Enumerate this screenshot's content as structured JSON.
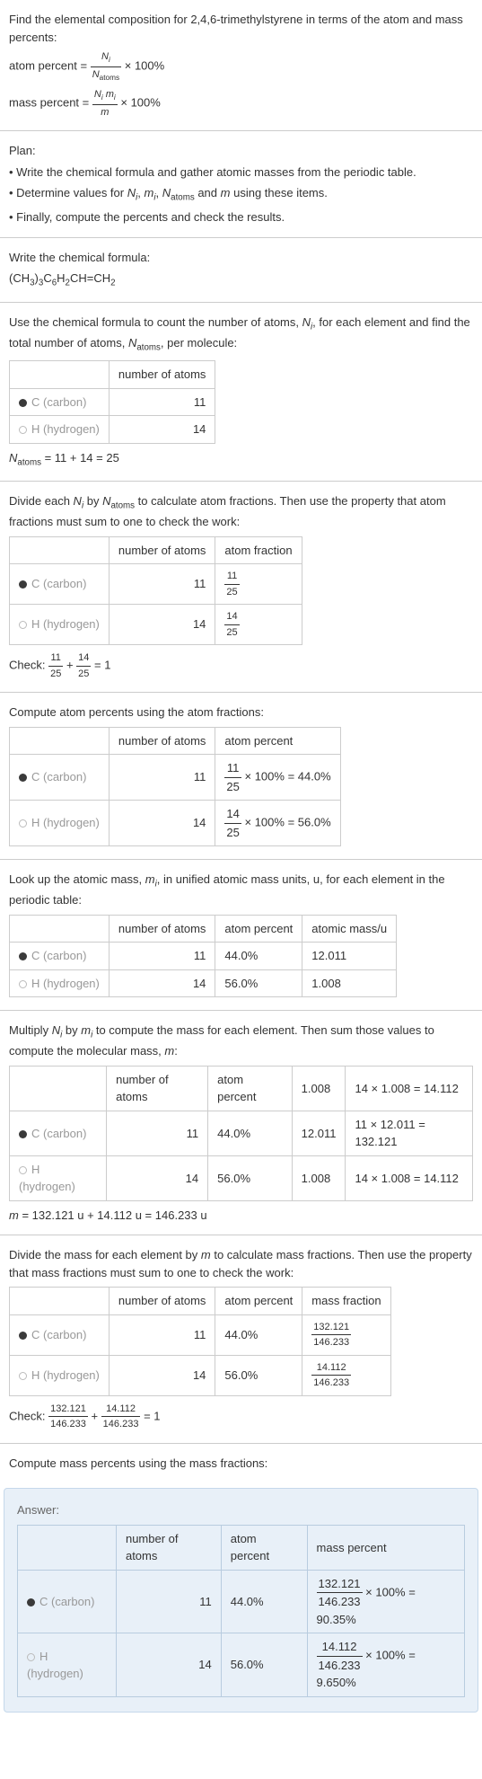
{
  "intro": {
    "line1": "Find the elemental composition for 2,4,6-trimethylstyrene in terms of the atom and mass percents:",
    "atom_label": "atom percent = ",
    "atom_frac_num": "N_i",
    "atom_frac_den": "N_atoms",
    "times100": " × 100%",
    "mass_label": "mass percent = ",
    "mass_frac_num": "N_i m_i",
    "mass_frac_den": "m"
  },
  "plan": {
    "title": "Plan:",
    "b1": "• Write the chemical formula and gather atomic masses from the periodic table.",
    "b2_a": "• Determine values for ",
    "b2_b": "N_i, m_i, N_atoms",
    "b2_c": " and ",
    "b2_d": "m",
    "b2_e": " using these items.",
    "b3": "• Finally, compute the percents and check the results."
  },
  "formula_section": {
    "title": "Write the chemical formula:",
    "formula": "(CH₃)₃C₆H₂CH=CH₂"
  },
  "count_section": {
    "text_a": "Use the chemical formula to count the number of atoms, ",
    "text_b": "N_i",
    "text_c": ", for each element and find the total number of atoms, ",
    "text_d": "N_atoms",
    "text_e": ", per molecule:",
    "h_atoms": "number of atoms",
    "c_label": "C (carbon)",
    "c_atoms": "11",
    "h_label": "H (hydrogen)",
    "h_atoms_val": "14",
    "eq": "N_atoms = 11 + 14 = 25"
  },
  "atomfrac_section": {
    "text_a": "Divide each ",
    "text_b": "N_i",
    "text_c": " by ",
    "text_d": "N_atoms",
    "text_e": " to calculate atom fractions. Then use the property that atom fractions must sum to one to check the work:",
    "h_atoms": "number of atoms",
    "h_frac": "atom fraction",
    "c_atoms": "11",
    "c_frac_num": "11",
    "c_frac_den": "25",
    "h_atoms_val": "14",
    "h_frac_num": "14",
    "h_frac_den": "25",
    "check_label": "Check: ",
    "check_eq": " = 1"
  },
  "atompct_section": {
    "title": "Compute atom percents using the atom fractions:",
    "h_atoms": "number of atoms",
    "h_pct": "atom percent",
    "c_atoms": "11",
    "c_calc": " × 100% = 44.0%",
    "h_atoms_val": "14",
    "h_calc": " × 100% = 56.0%"
  },
  "mass_lookup": {
    "text_a": "Look up the atomic mass, ",
    "text_b": "m_i",
    "text_c": ", in unified atomic mass units, u, for each element in the periodic table:",
    "h_atoms": "number of atoms",
    "h_pct": "atom percent",
    "h_mass": "atomic mass/u",
    "c_atoms": "11",
    "c_pct": "44.0%",
    "c_mass": "12.011",
    "h_atoms_val": "14",
    "h_pct_val": "56.0%",
    "h_mass_val": "1.008"
  },
  "massmult": {
    "text_a": "Multiply ",
    "text_b": "N_i",
    "text_c": " by ",
    "text_d": "m_i",
    "text_e": " to compute the mass for each element. Then sum those values to compute the molecular mass, ",
    "text_f": "m:",
    "h_atoms": "number of atoms",
    "h_pct": "atom percent",
    "h_amass": "1.008",
    "h_mass": "14 × 1.008 = 14.112",
    "c_atoms": "11",
    "c_pct": "44.0%",
    "c_amass": "12.011",
    "c_mass": "11 × 12.011 = 132.121",
    "h_atoms_val": "14",
    "h_pct_val": "56.0%",
    "eq": "m = 132.121 u + 14.112 u = 146.233 u"
  },
  "massfrac": {
    "text_a": "Divide the mass for each element by ",
    "text_b": "m",
    "text_c": " to calculate mass fractions. Then use the property that mass fractions must sum to one to check the work:",
    "h_atoms": "number of atoms",
    "h_pct": "atom percent",
    "h_mfrac": "mass fraction",
    "c_atoms": "11",
    "c_pct": "44.0%",
    "c_num": "132.121",
    "c_den": "146.233",
    "h_atoms_val": "14",
    "h_pct_val": "56.0%",
    "h_num": "14.112",
    "h_den": "146.233",
    "check_label": "Check: ",
    "check_eq": " = 1"
  },
  "masspct": {
    "title": "Compute mass percents using the mass fractions:"
  },
  "answer": {
    "title": "Answer:",
    "h_atoms": "number of atoms",
    "h_pct": "atom percent",
    "h_mpct": "mass percent",
    "c_atoms": "11",
    "c_pct": "44.0%",
    "c_num": "132.121",
    "c_den": "146.233",
    "c_calc": " × 100% = 90.35%",
    "h_atoms_val": "14",
    "h_pct_val": "56.0%",
    "h_num": "14.112",
    "h_den": "146.233",
    "h_calc": " × 100% = 9.650%"
  },
  "elements": {
    "c": "C (carbon)",
    "h": "H (hydrogen)"
  }
}
